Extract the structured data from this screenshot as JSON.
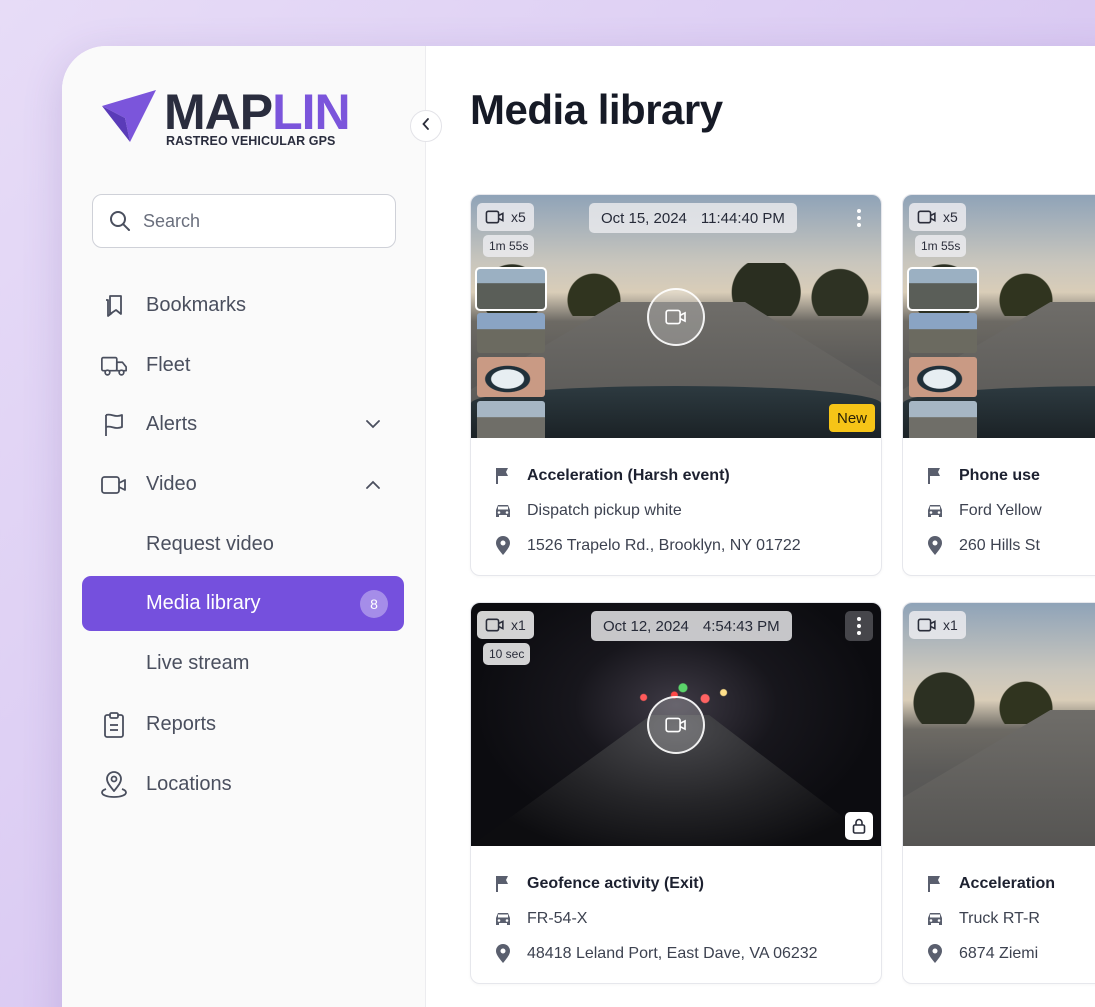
{
  "brand": {
    "name_part1": "MAP",
    "name_part2": "LIN",
    "tagline": "RASTREO VEHICULAR GPS",
    "colors": {
      "dark": "#2a2d3e",
      "accent": "#7b55db"
    }
  },
  "sidebar": {
    "collapse_icon": "chevron-left-icon",
    "search": {
      "placeholder": "Search",
      "value": ""
    },
    "items": [
      {
        "label": "Bookmarks",
        "icon": "bookmarks-icon"
      },
      {
        "label": "Fleet",
        "icon": "truck-icon"
      },
      {
        "label": "Alerts",
        "icon": "flag-icon",
        "chevron": "down"
      },
      {
        "label": "Video",
        "icon": "video-icon",
        "chevron": "up"
      },
      {
        "label": "Request video",
        "sub": true
      },
      {
        "label": "Media library",
        "sub": true,
        "active": true,
        "badge": "8"
      },
      {
        "label": "Live stream",
        "sub": true
      },
      {
        "label": "Reports",
        "icon": "clipboard-icon"
      },
      {
        "label": "Locations",
        "icon": "location-pin-icon"
      }
    ]
  },
  "main": {
    "title": "Media library",
    "cards": [
      {
        "camera_count": "x5",
        "duration": "1m 55s",
        "date": "Oct 15, 2024",
        "time": "11:44:40 PM",
        "badge": "New",
        "event": "Acceleration (Harsh event)",
        "vehicle": "Dispatch pickup white",
        "address": "1526 Trapelo Rd., Brooklyn, NY 01722"
      },
      {
        "camera_count": "x5",
        "duration": "1m 55s",
        "event": "Phone use",
        "vehicle": "Ford Yellow",
        "address": "260 Hills St"
      },
      {
        "camera_count": "x1",
        "duration": "10 sec",
        "date": "Oct 12, 2024",
        "time": "4:54:43 PM",
        "locked": true,
        "event": "Geofence activity (Exit)",
        "vehicle": "FR-54-X",
        "address": "48418 Leland Port, East Dave, VA 06232"
      },
      {
        "camera_count": "x1",
        "event": "Acceleration",
        "vehicle": "Truck RT-R",
        "address": "6874 Ziemi"
      }
    ]
  },
  "colors": {
    "active_nav": "#7550dd",
    "new_badge": "#f6c417"
  }
}
